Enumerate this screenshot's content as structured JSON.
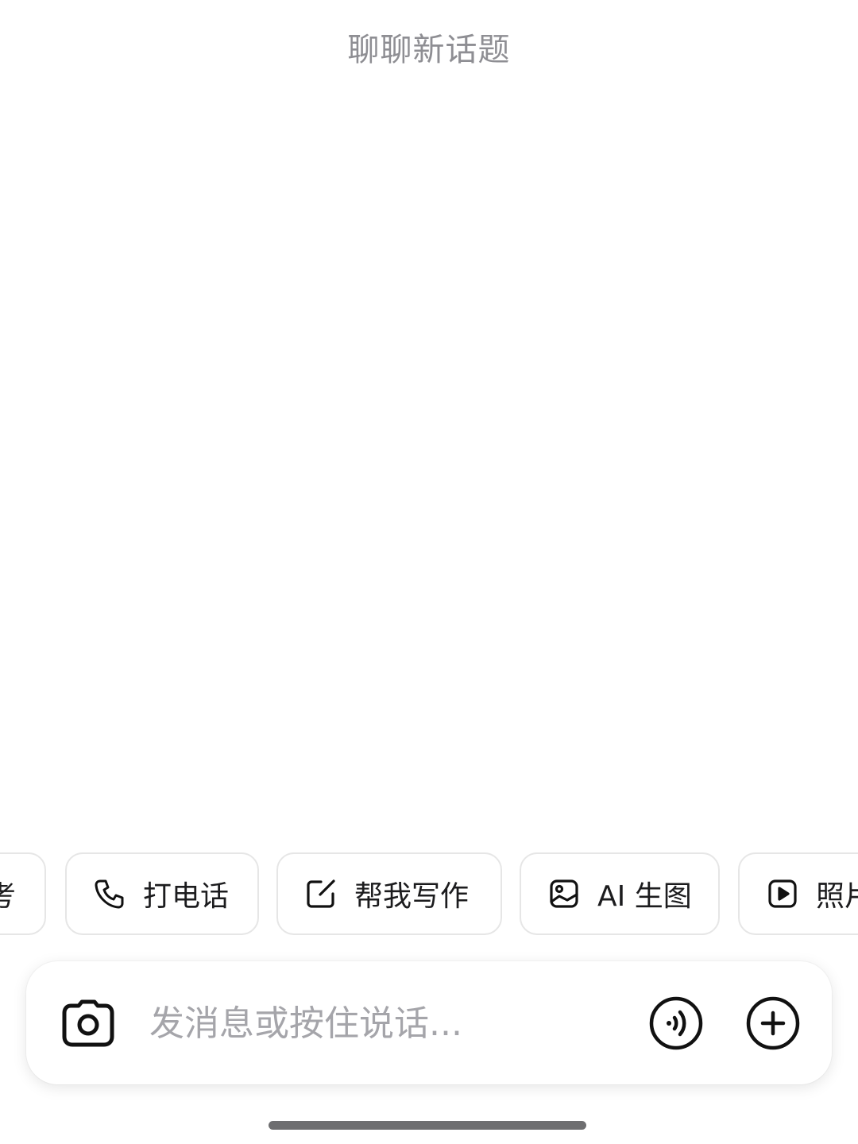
{
  "header": {
    "title": "聊聊新话题"
  },
  "suggestions": {
    "items": [
      {
        "label": "考",
        "icon": "none"
      },
      {
        "label": "打电话",
        "icon": "phone-icon"
      },
      {
        "label": "帮我写作",
        "icon": "edit-icon"
      },
      {
        "label": "AI 生图",
        "icon": "image-icon"
      },
      {
        "label": "照片",
        "icon": "video-play-icon"
      }
    ]
  },
  "composer": {
    "placeholder": "发消息或按住说话...",
    "value": "",
    "camera_icon": "camera-icon",
    "voice_icon": "voice-call-icon",
    "add_icon": "plus-circle-icon"
  },
  "colors": {
    "title_text": "#8e8e93",
    "placeholder_text": "#a5a5aa",
    "chip_border": "#e6e6e6",
    "icon_stroke": "#111111",
    "home_indicator": "#6e6e70"
  }
}
